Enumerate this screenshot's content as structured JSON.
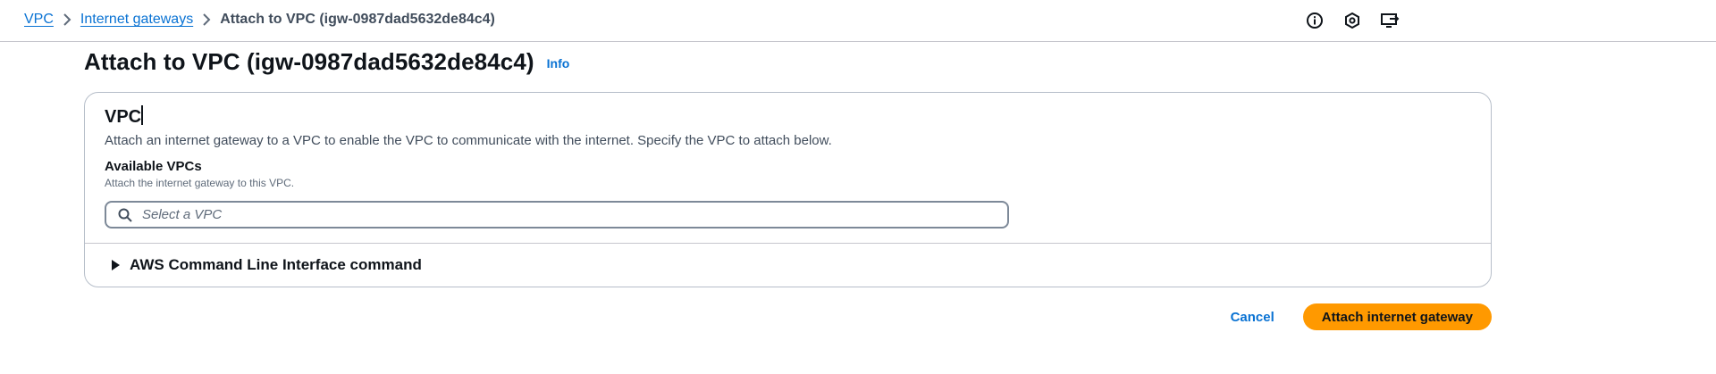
{
  "breadcrumb": {
    "items": [
      {
        "label": "VPC"
      },
      {
        "label": "Internet gateways"
      }
    ],
    "current": "Attach to VPC (igw-0987dad5632de84c4)"
  },
  "top_icons": [
    "info-icon",
    "hexagon-icon",
    "screen-share-icon"
  ],
  "header": {
    "title": "Attach to VPC (igw-0987dad5632de84c4)",
    "info_label": "Info"
  },
  "section": {
    "heading": "VPC",
    "description": "Attach an internet gateway to a VPC to enable the VPC to communicate with the internet. Specify the VPC to attach below.",
    "field_label": "Available VPCs",
    "field_description": "Attach the internet gateway to this VPC.",
    "search_placeholder": "Select a VPC",
    "search_value": "",
    "expander_label": "AWS Command Line Interface command"
  },
  "actions": {
    "cancel_label": "Cancel",
    "primary_label": "Attach internet gateway"
  },
  "colors": {
    "link": "#0972d3",
    "primary_button": "#ff9900",
    "border": "#b6bec9",
    "heading_text": "#0f141a"
  }
}
